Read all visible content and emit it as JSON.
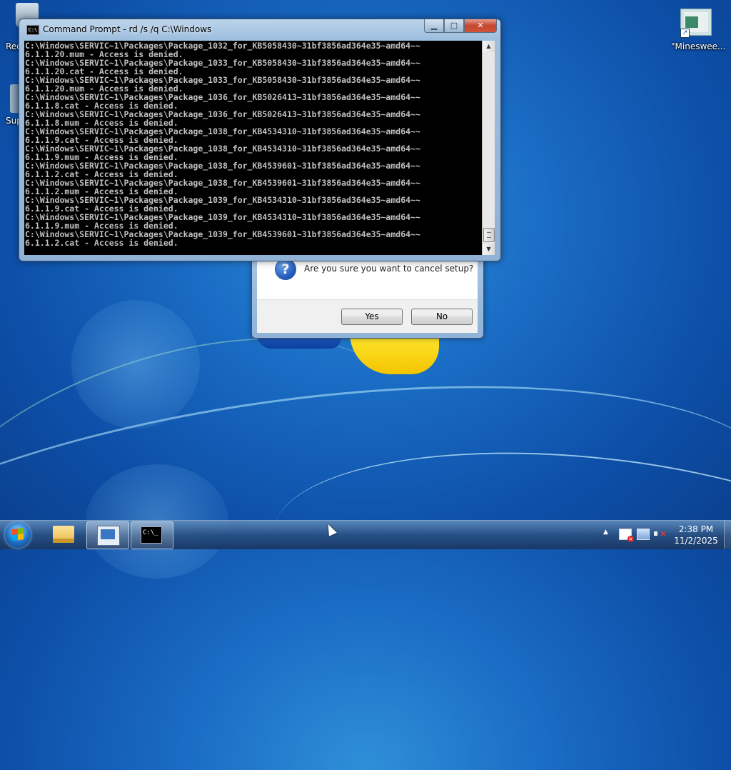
{
  "desktop": {
    "icons": [
      {
        "label": "Rec",
        "icon": "recycle-bin-icon"
      },
      {
        "label": "Sup",
        "icon": "support-icon"
      },
      {
        "label": "\"Mineswee...",
        "icon": "minesweeper-shortcut-icon"
      }
    ]
  },
  "cmd_window": {
    "title": "Command Prompt - rd  /s /q C:\\Windows",
    "title_icon": "C:\\",
    "lines": [
      "C:\\Windows\\SERVIC~1\\Packages\\Package_1032_for_KB5058430~31bf3856ad364e35~amd64~~",
      "6.1.1.20.mum - Access is denied.",
      "C:\\Windows\\SERVIC~1\\Packages\\Package_1033_for_KB5058430~31bf3856ad364e35~amd64~~",
      "6.1.1.20.cat - Access is denied.",
      "C:\\Windows\\SERVIC~1\\Packages\\Package_1033_for_KB5058430~31bf3856ad364e35~amd64~~",
      "6.1.1.20.mum - Access is denied.",
      "C:\\Windows\\SERVIC~1\\Packages\\Package_1036_for_KB5026413~31bf3856ad364e35~amd64~~",
      "6.1.1.8.cat - Access is denied.",
      "C:\\Windows\\SERVIC~1\\Packages\\Package_1036_for_KB5026413~31bf3856ad364e35~amd64~~",
      "6.1.1.8.mum - Access is denied.",
      "C:\\Windows\\SERVIC~1\\Packages\\Package_1038_for_KB4534310~31bf3856ad364e35~amd64~~",
      "6.1.1.9.cat - Access is denied.",
      "C:\\Windows\\SERVIC~1\\Packages\\Package_1038_for_KB4534310~31bf3856ad364e35~amd64~~",
      "6.1.1.9.mum - Access is denied.",
      "C:\\Windows\\SERVIC~1\\Packages\\Package_1038_for_KB4539601~31bf3856ad364e35~amd64~~",
      "6.1.1.2.cat - Access is denied.",
      "C:\\Windows\\SERVIC~1\\Packages\\Package_1038_for_KB4539601~31bf3856ad364e35~amd64~~",
      "6.1.1.2.mum - Access is denied.",
      "C:\\Windows\\SERVIC~1\\Packages\\Package_1039_for_KB4534310~31bf3856ad364e35~amd64~~",
      "6.1.1.9.cat - Access is denied.",
      "C:\\Windows\\SERVIC~1\\Packages\\Package_1039_for_KB4534310~31bf3856ad364e35~amd64~~",
      "6.1.1.9.mum - Access is denied.",
      "C:\\Windows\\SERVIC~1\\Packages\\Package_1039_for_KB4539601~31bf3856ad364e35~amd64~~",
      "6.1.1.2.cat - Access is denied."
    ],
    "buttons": {
      "minimize": "▁",
      "maximize": "□",
      "close": "✕"
    },
    "scroll": {
      "up": "▲",
      "down": "▼"
    }
  },
  "dialog": {
    "message": "Are you sure you want to cancel setup?",
    "icon_glyph": "?",
    "yes_label": "Yes",
    "no_label": "No"
  },
  "taskbar": {
    "items": [
      {
        "name": "Windows Explorer",
        "icon": "folder-icon"
      },
      {
        "name": "Setup",
        "icon": "setup-icon",
        "active": true
      },
      {
        "name": "Command Prompt",
        "icon": "cmd-icon",
        "active": true,
        "icon_text": "C:\\_"
      }
    ],
    "tray": {
      "arrow": "▲",
      "icons": [
        "action-center-flag-icon",
        "network-icon",
        "volume-muted-icon"
      ]
    },
    "clock": {
      "time": "2:38 PM",
      "date": "11/2/2025"
    }
  }
}
